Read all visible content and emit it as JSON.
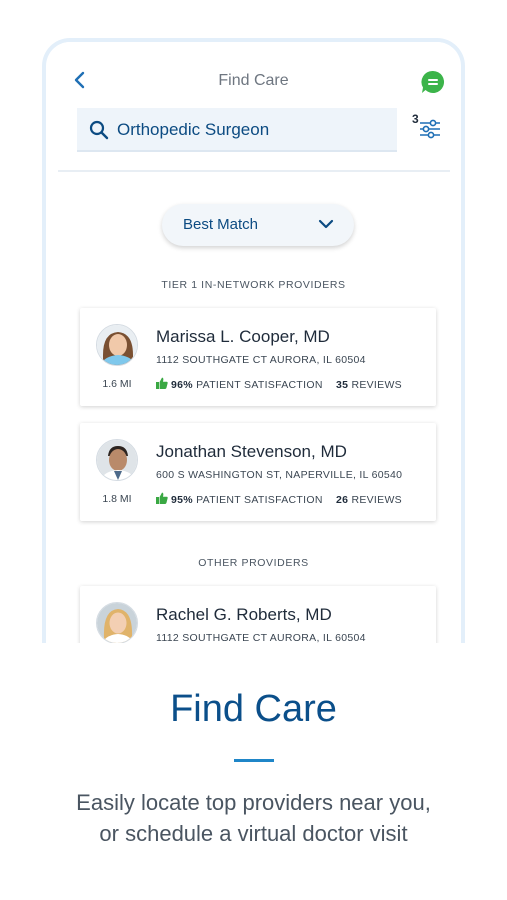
{
  "nav": {
    "title": "Find Care"
  },
  "search": {
    "value": "Orthopedic Surgeon"
  },
  "filter": {
    "badge": "3"
  },
  "sort": {
    "label": "Best Match"
  },
  "sections": [
    {
      "title": "TIER 1 IN-NETWORK PROVIDERS"
    },
    {
      "title": "OTHER PROVIDERS"
    }
  ],
  "providers": [
    {
      "name": "Marissa L. Cooper, MD",
      "address": "1112 SOUTHGATE CT AURORA, IL 60504",
      "distance": "1.6 MI",
      "satisfaction_pct": "96%",
      "satisfaction_label": "PATIENT SATISFACTION",
      "reviews_count": "35",
      "reviews_label": "REVIEWS"
    },
    {
      "name": "Jonathan Stevenson, MD",
      "address": "600 S WASHINGTON ST, NAPERVILLE, IL 60540",
      "distance": "1.8 MI",
      "satisfaction_pct": "95%",
      "satisfaction_label": "PATIENT SATISFACTION",
      "reviews_count": "26",
      "reviews_label": "REVIEWS"
    },
    {
      "name": "Rachel G. Roberts, MD",
      "address": "1112 SOUTHGATE CT AURORA, IL 60504"
    }
  ],
  "promo": {
    "title": "Find Care",
    "line1": "Easily locate top providers near you,",
    "line2": "or schedule a virtual doctor visit"
  },
  "colors": {
    "brand_blue": "#0c4b82",
    "accent_blue": "#1f86c8",
    "chat_green": "#3cb44a",
    "thumb_green": "#3aa843"
  },
  "icons": [
    "back-chevron-icon",
    "chat-icon",
    "search-icon",
    "filter-sliders-icon",
    "chevron-down-icon",
    "thumbs-up-icon"
  ]
}
